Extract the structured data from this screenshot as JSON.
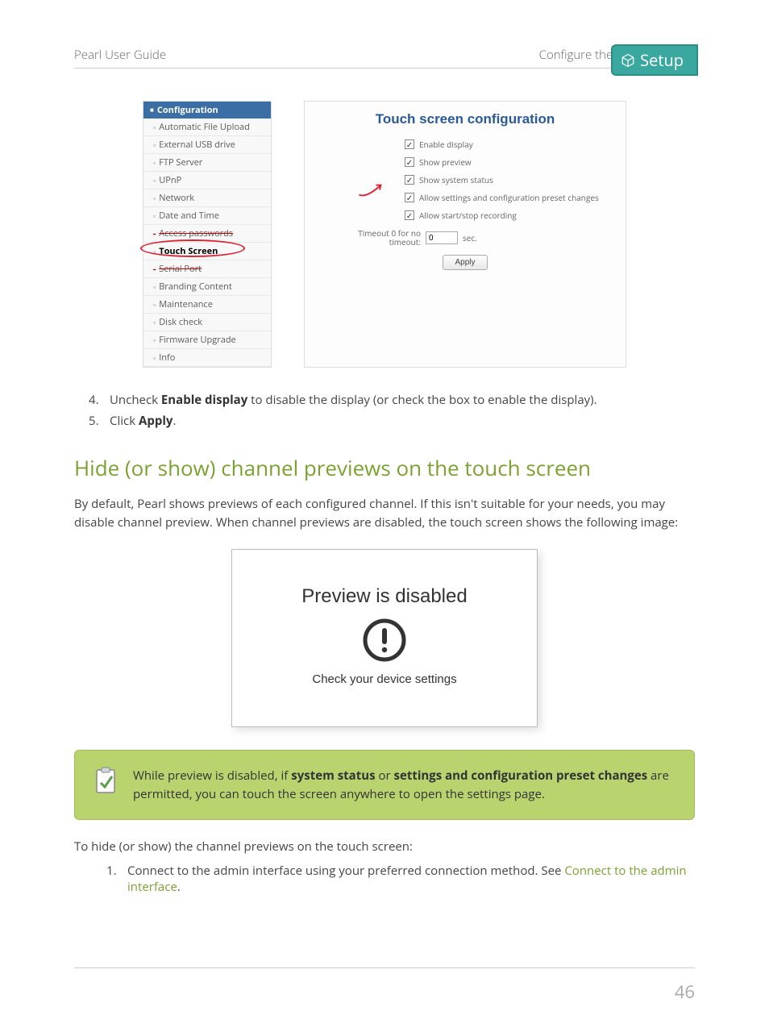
{
  "header": {
    "left": "Pearl User Guide",
    "mid": "Configure the touch screen",
    "pill": "Setup"
  },
  "sidebar": {
    "title": "Configuration",
    "items": [
      "Automatic File Upload",
      "External USB drive",
      "FTP Server",
      "UPnP",
      "Network",
      "Date and Time",
      "Access passwords",
      "Touch Screen",
      "Serial Port",
      "Branding Content",
      "Maintenance",
      "Disk check",
      "Firmware Upgrade",
      "Info"
    ],
    "struck_index": 6,
    "struck_index2": 8,
    "active_index": 7
  },
  "panel": {
    "title": "Touch screen configuration",
    "checks": [
      "Enable display",
      "Show preview",
      "Show system status",
      "Allow settings and configuration preset changes",
      "Allow start/stop recording"
    ],
    "timeout_label": "Timeout\n0 for no timeout:",
    "timeout_value": "0",
    "timeout_unit": "sec.",
    "apply": "Apply"
  },
  "steps_a": [
    {
      "n": "4.",
      "pre": "Uncheck ",
      "b": "Enable display",
      "post": " to disable the display (or check the box to enable the display)."
    },
    {
      "n": "5.",
      "pre": "Click ",
      "b": "Apply",
      "post": "."
    }
  ],
  "heading": "Hide (or show) channel previews on the touch screen",
  "para1": "By default, Pearl shows previews of each configured channel. If this isn't suitable for your needs, you may disable channel preview. When channel previews are disabled, the touch screen shows the following image:",
  "preview_box": {
    "t1": "Preview is disabled",
    "t2": "Check your device settings"
  },
  "note": {
    "pre": "While preview is disabled, if ",
    "b1": "system status",
    "mid": " or ",
    "b2": "settings and configuration preset changes",
    "post": " are permitted, you can touch the screen anywhere to open the settings page."
  },
  "para2": "To hide (or show) the channel previews on the touch screen:",
  "steps_b": [
    {
      "n": "1.",
      "pre": "Connect to the admin interface using your preferred connection method. See ",
      "link": "Connect to the admin interface",
      "post": "."
    }
  ],
  "pagenum": "46"
}
